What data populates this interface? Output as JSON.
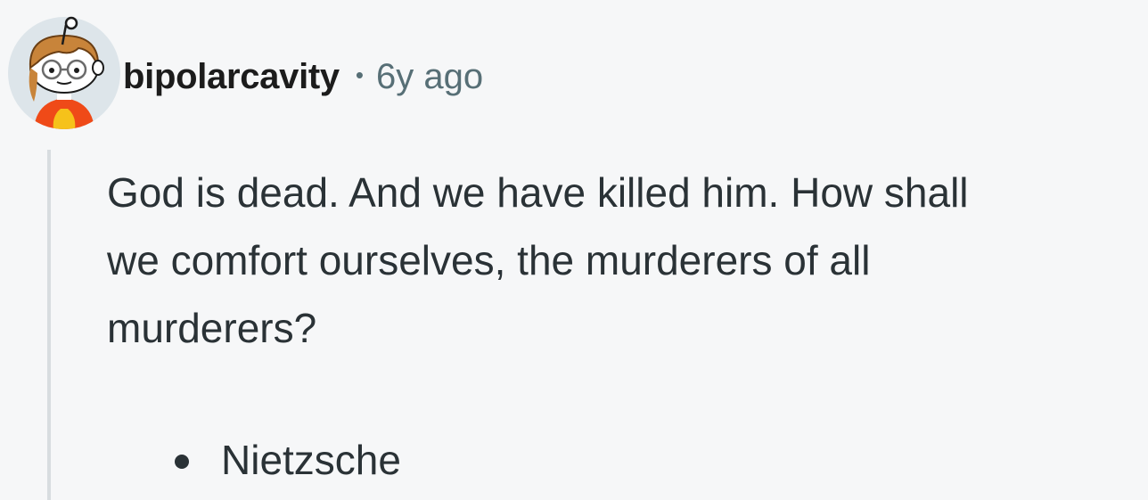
{
  "comment": {
    "author": "bipolarcavity",
    "separator": "•",
    "age": "6y ago",
    "body_lines": [
      "God is dead. And we have killed him. How shall",
      "we comfort ourselves, the murderers of all",
      "murderers?"
    ],
    "list_items": [
      "Nietzsche"
    ],
    "avatar_icon": "snoo-avatar-icon"
  },
  "colors": {
    "background": "#f6f7f8",
    "text": "#2a3236",
    "meta_text": "#576f76",
    "thread_line": "#d8dde0",
    "avatar_bg": "#dde5ea",
    "avatar_shirt": "#ef4a18"
  }
}
